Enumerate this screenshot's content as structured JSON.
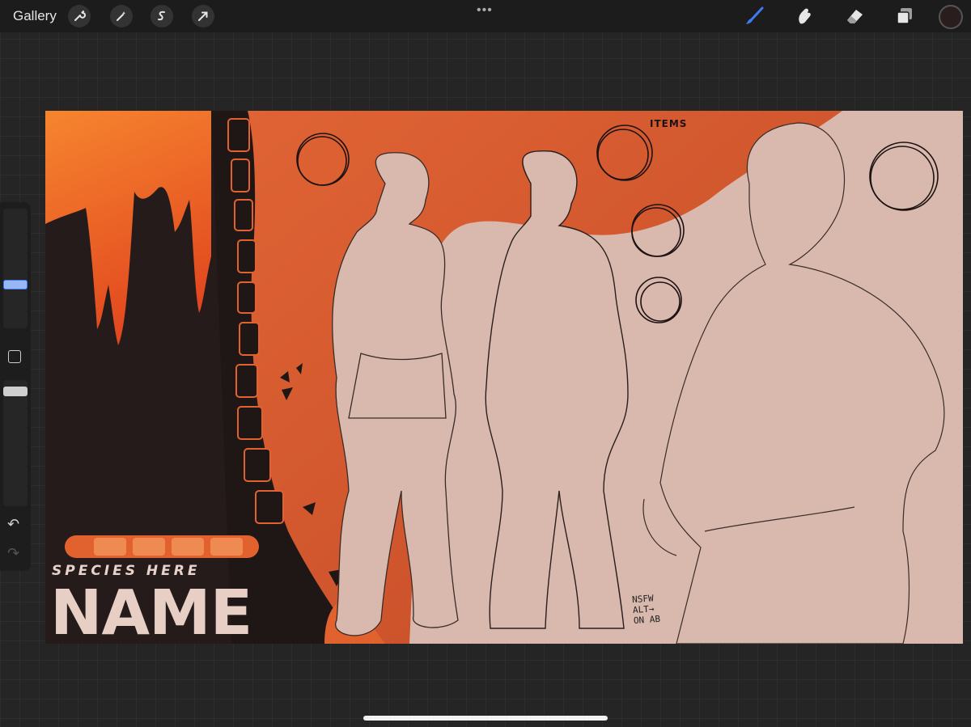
{
  "app": {
    "gallery_label": "Gallery"
  },
  "toolbar_left": [
    {
      "name": "actions",
      "icon": "wrench-icon"
    },
    {
      "name": "adjustments",
      "icon": "magic-wand-icon"
    },
    {
      "name": "selection",
      "icon": "selection-icon"
    },
    {
      "name": "transform",
      "icon": "arrow-cursor-icon"
    }
  ],
  "toolbar_right": [
    {
      "name": "brush",
      "icon": "brush-icon",
      "active": true
    },
    {
      "name": "smudge",
      "icon": "smudge-icon"
    },
    {
      "name": "eraser",
      "icon": "eraser-icon"
    },
    {
      "name": "layers",
      "icon": "layers-icon"
    },
    {
      "name": "color",
      "icon": "color-swatch"
    }
  ],
  "more_menu": "•••",
  "sidebar": {
    "brush_size_level": 0.62,
    "opacity_level": 0.9,
    "undo_icon": "undo-icon",
    "redo_icon": "redo-icon"
  },
  "artwork": {
    "items_title": "ITEMS",
    "species_text": "SPECIES HERE",
    "name_text": "NAME",
    "note_text": "NSFW\nALT→\nON AB"
  },
  "colors": {
    "accent_blue": "#3d7bf0",
    "toolbar_bg": "#1c1c1c",
    "canvas_bg": "#252525",
    "orange": "#e2622f",
    "dark": "#1f1716",
    "skin": "#d9b9ad"
  }
}
